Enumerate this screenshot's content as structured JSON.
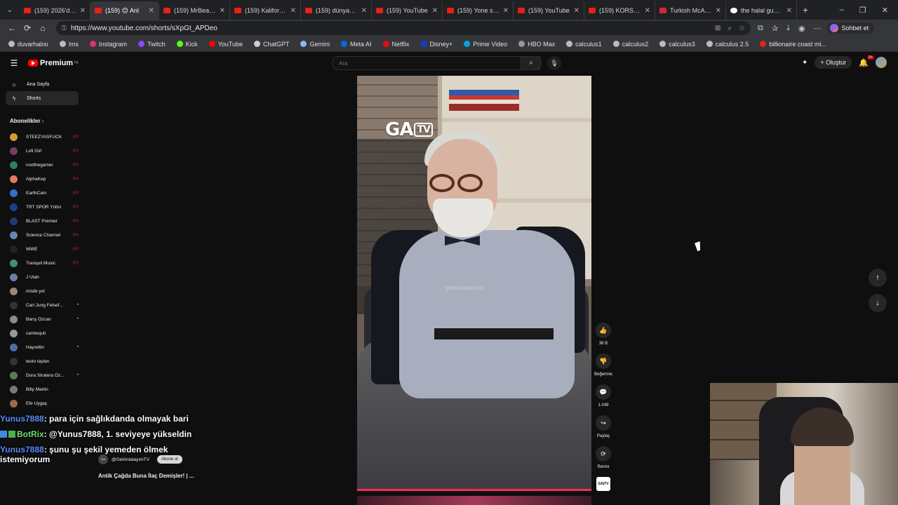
{
  "browser": {
    "tabs": [
      {
        "title": "(159) 2026'da Dü"
      },
      {
        "title": "(159) 😊 Anl"
      },
      {
        "title": "(159) MrBeast - Y"
      },
      {
        "title": "(159) Kaliforniya I"
      },
      {
        "title": "(159) dünyanın en"
      },
      {
        "title": "(159) YouTube"
      },
      {
        "title": "(159) Yone soiled"
      },
      {
        "title": "(159) YouTube"
      },
      {
        "title": "(159) KORSAN OY"
      },
      {
        "title": "Turkish McAllen, T"
      },
      {
        "title": "the halal guys mo"
      }
    ],
    "url": "https://www.youtube.com/shorts/sXpGt_APDeo",
    "copilot_label": "Sohbet et",
    "bookmarks": [
      "duvarhalısı",
      "lms",
      "Instagram",
      "Twitch",
      "Kick",
      "YouTube",
      "ChatGPT",
      "Gemini",
      "Meta AI",
      "Netflix",
      "Disney+",
      "Prime Video",
      "HBO Max",
      "calculus1",
      "calculus2",
      "calculus3",
      "calculus 2.5",
      "billionaire coast mi..."
    ]
  },
  "youtube": {
    "logo": "Premium",
    "logo_sup": "TR",
    "search_placeholder": "Ara",
    "create_label": "Oluştur",
    "notif_badge": "9+",
    "nav": [
      {
        "label": "Ana Sayfa",
        "icon": "home-icon"
      },
      {
        "label": "Shorts",
        "icon": "shorts-icon"
      }
    ],
    "subs_title": "Abonelikler",
    "subscriptions": [
      {
        "name": "STEEZYASFUCK",
        "mark": "live",
        "color": "#d49a3a"
      },
      {
        "name": "Lofi Girl",
        "mark": "live",
        "color": "#7a3b5e"
      },
      {
        "name": "rootthegamer",
        "mark": "live",
        "color": "#2a7f6f"
      },
      {
        "name": "AlphaKep",
        "mark": "live",
        "color": "#e07a5f"
      },
      {
        "name": "EarthCam",
        "mark": "live",
        "color": "#3a6ec7"
      },
      {
        "name": "TRT SPOR Yıldız",
        "mark": "live",
        "color": "#1c3f8a"
      },
      {
        "name": "BLAST Premier",
        "mark": "live",
        "color": "#233a6e"
      },
      {
        "name": "Science Channel",
        "mark": "live",
        "color": "#5b8bb5"
      },
      {
        "name": "WWE",
        "mark": "live",
        "color": "#222222"
      },
      {
        "name": "Tranquil Music",
        "mark": "live",
        "color": "#3f8f7a"
      },
      {
        "name": "J Utah",
        "mark": "",
        "color": "#6b7fa8"
      },
      {
        "name": "mistik yol",
        "mark": "",
        "color": "#a0837a"
      },
      {
        "name": "Carl Jung Felsef...",
        "mark": "dot",
        "color": "#333333"
      },
      {
        "name": "Barış Özcan",
        "mark": "dot",
        "color": "#8d8d8d"
      },
      {
        "name": "canbequit",
        "mark": "",
        "color": "#9a9a9a"
      },
      {
        "name": "Hayrettin",
        "mark": "dot",
        "color": "#4a6fa5"
      },
      {
        "name": "testo taylan",
        "mark": "",
        "color": "#333333"
      },
      {
        "name": "Dora Stratera Öz...",
        "mark": "dot",
        "color": "#5a7a5a"
      },
      {
        "name": "Billy Martin",
        "mark": "",
        "color": "#7a7a7a"
      },
      {
        "name": "Efe Uygaç",
        "mark": "",
        "color": "#9a6a4a"
      }
    ],
    "video": {
      "logo_text": "GA",
      "logo_tv": "TV",
      "watermark": "gelanlatay.am",
      "channel": "@GelAnlatayımTV",
      "channel_avatar": "GA",
      "subscribe_label": "Abone ol",
      "title": "Antik Çağda Buna İlaç Demişler! | ..."
    },
    "actions": [
      {
        "icon": "like-icon",
        "glyph": "👍",
        "label": "38 B"
      },
      {
        "icon": "dislike-icon",
        "glyph": "👎",
        "label": "Beğenme"
      },
      {
        "icon": "comment-icon",
        "glyph": "💬",
        "label": "1.049"
      },
      {
        "icon": "share-icon",
        "glyph": "↪",
        "label": "Paylaş"
      },
      {
        "icon": "remix-icon",
        "glyph": "⟳",
        "label": "Remix"
      }
    ],
    "sound_thumb": "GA|TV"
  },
  "chat": [
    {
      "user": "Yunus7888",
      "text": ": para için sağlıkdanda olmayak bari",
      "color": "blue"
    },
    {
      "user": "BotRix",
      "text": ": @Yunus7888, 1. seviyeye yükseldin",
      "color": "green"
    },
    {
      "user": "Yunus7888",
      "text": ": şunu şu şekil yemeden ölmek istemiyorum",
      "color": "blue"
    }
  ]
}
